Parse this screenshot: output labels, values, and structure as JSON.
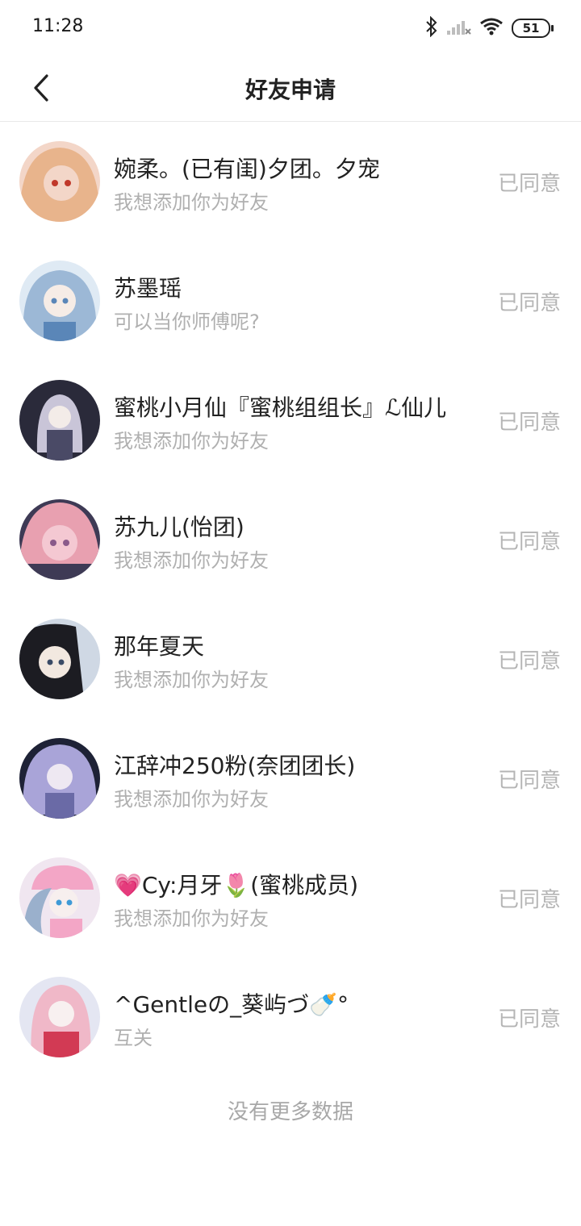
{
  "status_bar": {
    "time": "11:28",
    "battery": "51"
  },
  "header": {
    "title": "好友申请"
  },
  "requests": [
    {
      "name": "婉柔。(已有闺)夕团。夕宠",
      "message": "我想添加你为好友",
      "status": "已同意",
      "avatar_colors": [
        "#f3d6c8",
        "#e8b48c",
        "#c0392b"
      ]
    },
    {
      "name": "苏墨瑶",
      "message": "可以当你师傅呢?",
      "status": "已同意",
      "avatar_colors": [
        "#dfeaf4",
        "#9cb8d6",
        "#5a86b8"
      ]
    },
    {
      "name": "蜜桃小月仙『蜜桃组组长』ℒ仙儿",
      "message": "我想添加你为好友",
      "status": "已同意",
      "avatar_colors": [
        "#2a2a3a",
        "#c9c5d8",
        "#4a4a66"
      ]
    },
    {
      "name": "苏九儿(怡团)",
      "message": "我想添加你为好友",
      "status": "已同意",
      "avatar_colors": [
        "#3e3a55",
        "#e8a0b0",
        "#f4c8d2"
      ]
    },
    {
      "name": "那年夏天",
      "message": "我想添加你为好友",
      "status": "已同意",
      "avatar_colors": [
        "#cfd8e4",
        "#1c1c22",
        "#f2e8e0"
      ]
    },
    {
      "name": "江辞冲250粉(奈团团长)",
      "message": "我想添加你为好友",
      "status": "已同意",
      "avatar_colors": [
        "#1e2236",
        "#a9a4d8",
        "#6a6aa6"
      ]
    },
    {
      "name": "💗Cy:月牙🌷(蜜桃成员)",
      "message": "我想添加你为好友",
      "status": "已同意",
      "avatar_colors": [
        "#f0e6f0",
        "#f3a6c6",
        "#9ab0cc"
      ]
    },
    {
      "name": "^Gentleの_葵屿づ🍼°",
      "message": "互关",
      "status": "已同意",
      "avatar_colors": [
        "#e4e6f2",
        "#f0b8c8",
        "#d23a54"
      ]
    }
  ],
  "footer": {
    "no_more": "没有更多数据"
  }
}
